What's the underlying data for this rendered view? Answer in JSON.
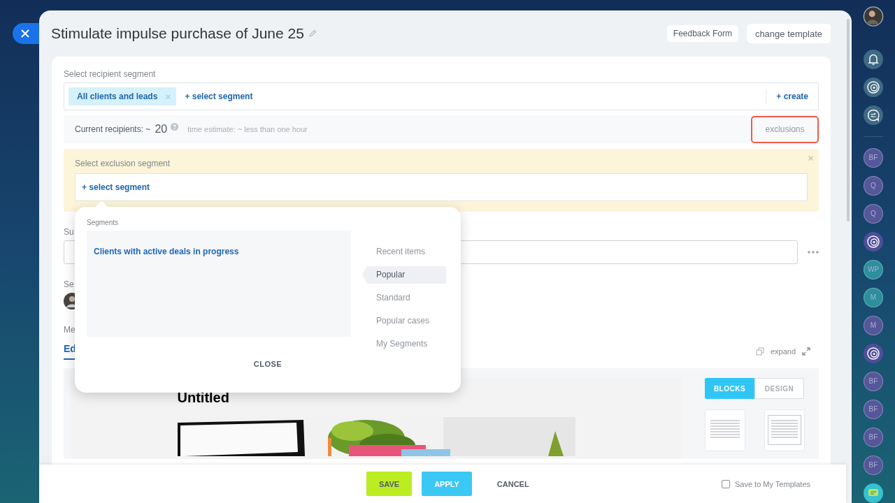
{
  "panel": {
    "title": "Stimulate impulse purchase of June 25",
    "header_buttons": [
      "Feedback Form",
      "change template"
    ]
  },
  "recipients": {
    "label": "Select recipient segment",
    "tags": [
      {
        "label": "All clients and leads"
      }
    ],
    "add_link": "+ select segment",
    "create_link": "+ create",
    "count_label": "Current recipients: ~",
    "count": "20",
    "estimate": "time estimate: ~ less than one hour",
    "exclusions_button": "exclusions"
  },
  "exclusion": {
    "label": "Select exclusion segment",
    "add_link": "+ select segment"
  },
  "popup": {
    "title": "Segments",
    "items": [
      "Clients with active deals in progress"
    ],
    "categories": [
      {
        "label": "Recent items",
        "selected": false
      },
      {
        "label": "Popular",
        "selected": true
      },
      {
        "label": "Standard",
        "selected": false
      },
      {
        "label": "Popular cases",
        "selected": false
      },
      {
        "label": "My Segments",
        "selected": false
      }
    ],
    "close": "CLOSE"
  },
  "behind": {
    "subject_label": "Su",
    "sender_label": "Se",
    "message_label": "Me",
    "tabs": [
      {
        "label": "Ed",
        "selected": true
      }
    ]
  },
  "editor": {
    "expand": "expand",
    "heading": "Untitled",
    "modes": [
      {
        "label": "BLOCKS",
        "selected": true
      },
      {
        "label": "DESIGN",
        "selected": false
      }
    ]
  },
  "footer": {
    "buttons": [
      {
        "label": "SAVE",
        "kind": "save"
      },
      {
        "label": "APPLY",
        "kind": "apply"
      },
      {
        "label": "CANCEL",
        "kind": "cancel"
      }
    ],
    "save_template": {
      "label": "Save to My Templates",
      "checked": false
    }
  },
  "rail": [
    {
      "kind": "avatar"
    },
    {
      "kind": "separator"
    },
    {
      "kind": "bell"
    },
    {
      "kind": "spiral"
    },
    {
      "kind": "chat"
    },
    {
      "kind": "line"
    },
    {
      "kind": "initials",
      "text": "BF",
      "color": "#55579a"
    },
    {
      "kind": "initials",
      "text": "Q",
      "color": "#55579a"
    },
    {
      "kind": "initials",
      "text": "Q",
      "color": "#55579a"
    },
    {
      "kind": "spiral"
    },
    {
      "kind": "initials",
      "text": "WP",
      "color": "#2b8f9c"
    },
    {
      "kind": "initials",
      "text": "M",
      "color": "#2b8f9c"
    },
    {
      "kind": "initials",
      "text": "M",
      "color": "#55579a"
    },
    {
      "kind": "spiral"
    },
    {
      "kind": "initials",
      "text": "BF",
      "color": "#55579a"
    },
    {
      "kind": "initials",
      "text": "BF",
      "color": "#55579a"
    },
    {
      "kind": "initials",
      "text": "BF",
      "color": "#55579a"
    },
    {
      "kind": "initials",
      "text": "BF",
      "color": "#55579a"
    },
    {
      "kind": "message"
    }
  ]
}
